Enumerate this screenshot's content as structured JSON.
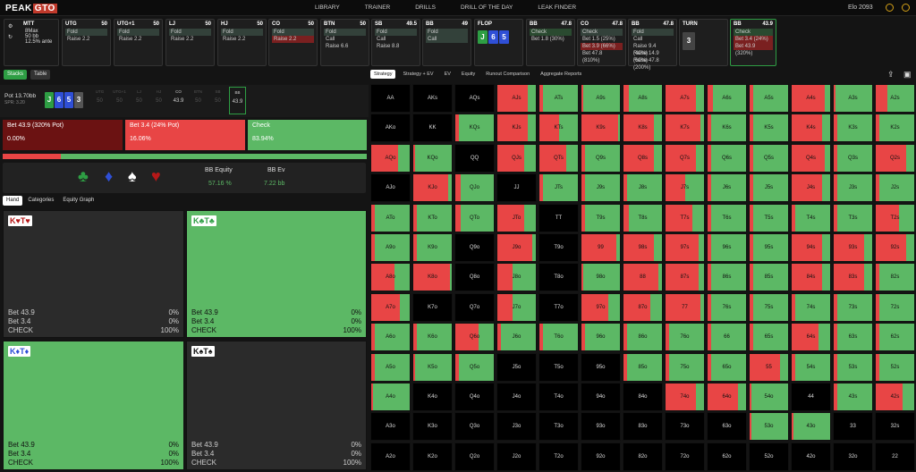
{
  "brand": {
    "name": "PEAK",
    "accent": "GTO"
  },
  "nav": [
    "LIBRARY",
    "TRAINER",
    "DRILLS",
    "DRILL OF THE DAY",
    "LEAK FINDER"
  ],
  "elo": "Elo 2093",
  "game": {
    "type": "MTT",
    "max": "8Max",
    "depth": "50 bb",
    "ante": "12.5% ante"
  },
  "seats": [
    {
      "name": "UTG",
      "stack": "50",
      "acts": [
        "Fold",
        "Raise 2.2"
      ],
      "hi": 0
    },
    {
      "name": "UTG+1",
      "stack": "50",
      "acts": [
        "Fold",
        "Raise 2.2"
      ],
      "hi": 0
    },
    {
      "name": "LJ",
      "stack": "50",
      "acts": [
        "Fold",
        "Raise 2.2"
      ],
      "hi": 0
    },
    {
      "name": "HJ",
      "stack": "50",
      "acts": [
        "Fold",
        "Raise 2.2"
      ],
      "hi": 0
    },
    {
      "name": "CO",
      "stack": "50",
      "acts": [
        "Fold",
        "Raise 2.2"
      ],
      "hi": 1
    },
    {
      "name": "BTN",
      "stack": "50",
      "acts": [
        "Fold",
        "Call",
        "Raise 6.6"
      ],
      "hi": 0
    },
    {
      "name": "SB",
      "stack": "49.5",
      "acts": [
        "Fold",
        "Call",
        "Raise 8.8"
      ],
      "hi": 0
    },
    {
      "name": "BB",
      "stack": "49",
      "acts": [
        "Fold",
        "Call"
      ],
      "hi": 1
    },
    {
      "name": "FLOP",
      "stack": "",
      "acts": [],
      "hi": 0
    },
    {
      "name": "BB",
      "stack": "47.8",
      "acts": [
        "Check",
        "Bet 1.8 (30%)"
      ],
      "hi": 0
    },
    {
      "name": "CO",
      "stack": "47.8",
      "acts": [
        "Check",
        "Bet 1.5 (25%)",
        "Bet 3.9 (66%)",
        "Bet 47.8 (810%)"
      ],
      "hi": 2
    },
    {
      "name": "BB",
      "stack": "47.8",
      "acts": [
        "Fold",
        "Call",
        "Raise 9.4 (40%)",
        "Raise 14.9 (60%)",
        "Raise 47.8 (200%)"
      ],
      "hi": 0
    },
    {
      "name": "TURN",
      "stack": "",
      "acts": [],
      "hi": 0
    },
    {
      "name": "BB",
      "stack": "43.9",
      "acts": [
        "Check",
        "Bet 3.4 (24%)",
        "Bet 43.9 (320%)"
      ],
      "hi": 0
    }
  ],
  "flop": [
    {
      "r": "J",
      "c": "#2e9e44"
    },
    {
      "r": "6",
      "c": "#2f4fd6"
    },
    {
      "r": "5",
      "c": "#2f4fd6"
    }
  ],
  "turn": {
    "r": "3",
    "c": "#444"
  },
  "tabs": {
    "stacks": "Stacks",
    "table": "Table"
  },
  "pot": {
    "label": "Pot",
    "value": "13.70bb",
    "spr": "SPR: 3.20",
    "board": [
      "J",
      "6",
      "5",
      "3"
    ],
    "pos": [
      {
        "n": "UTG",
        "v": "50"
      },
      {
        "n": "UTG+1",
        "v": "50"
      },
      {
        "n": "LJ",
        "v": "50"
      },
      {
        "n": "HJ",
        "v": "50"
      },
      {
        "n": "CO",
        "v": "43.9"
      },
      {
        "n": "BTN",
        "v": "50"
      },
      {
        "n": "SB",
        "v": "50"
      },
      {
        "n": "BB",
        "v": "43.9"
      }
    ]
  },
  "strategy": [
    {
      "label": "Bet 43.9 (320% Pot)",
      "pct": "0.00%",
      "color": "#6b1212"
    },
    {
      "label": "Bet 3.4 (24% Pot)",
      "pct": "16.06%",
      "color": "#e84545"
    },
    {
      "label": "Check",
      "pct": "83.94%",
      "color": "#5cb865"
    }
  ],
  "stats": {
    "eq_label": "BB Equity",
    "eq": "57.16 %",
    "ev_label": "BB Ev",
    "ev": "7.22 bb"
  },
  "subtabs": [
    "Hand",
    "Categories",
    "Equity Graph"
  ],
  "hands": [
    {
      "label": "K♥T♥",
      "suit": "h",
      "a": "0%",
      "b": "0%",
      "c": "100%",
      "green": false
    },
    {
      "label": "K♣T♣",
      "suit": "c",
      "a": "0%",
      "b": "0%",
      "c": "100%",
      "green": true
    },
    {
      "label": "K♦T♦",
      "suit": "d",
      "a": "0%",
      "b": "0%",
      "c": "100%",
      "green": true
    },
    {
      "label": "K♠T♠",
      "suit": "s",
      "a": "0%",
      "b": "0%",
      "c": "100%",
      "green": false
    }
  ],
  "handrows": {
    "a": "Bet 43.9",
    "b": "Bet 3.4",
    "c": "CHECK"
  },
  "gridtabs": [
    "Strategy",
    "Strategy + EV",
    "EV",
    "Equity",
    "Runout Comparison",
    "Aggregate Reports"
  ],
  "grid": [
    [
      "AA",
      "AKs",
      "AQs",
      "AJs",
      "ATs",
      "A9s",
      "A8s",
      "A7s",
      "A6s",
      "A5s",
      "A4s",
      "A3s",
      "A2s"
    ],
    [
      "AKo",
      "KK",
      "KQs",
      "KJs",
      "KTs",
      "K9s",
      "K8s",
      "K7s",
      "K6s",
      "K5s",
      "K4s",
      "K3s",
      "K2s"
    ],
    [
      "AQo",
      "KQo",
      "QQ",
      "QJs",
      "QTs",
      "Q9s",
      "Q8s",
      "Q7s",
      "Q6s",
      "Q5s",
      "Q4s",
      "Q3s",
      "Q2s"
    ],
    [
      "AJo",
      "KJo",
      "QJo",
      "JJ",
      "JTs",
      "J9s",
      "J8s",
      "J7s",
      "J6s",
      "J5s",
      "J4s",
      "J3s",
      "J2s"
    ],
    [
      "ATo",
      "KTo",
      "QTo",
      "JTo",
      "TT",
      "T9s",
      "T8s",
      "T7s",
      "T6s",
      "T5s",
      "T4s",
      "T3s",
      "T2s"
    ],
    [
      "A9o",
      "K9o",
      "Q9o",
      "J9o",
      "T9o",
      "99",
      "98s",
      "97s",
      "96s",
      "95s",
      "94s",
      "93s",
      "92s"
    ],
    [
      "A8o",
      "K8o",
      "Q8o",
      "J8o",
      "T8o",
      "98o",
      "88",
      "87s",
      "86s",
      "85s",
      "84s",
      "83s",
      "82s"
    ],
    [
      "A7o",
      "K7o",
      "Q7o",
      "J7o",
      "T7o",
      "97o",
      "87o",
      "77",
      "76s",
      "75s",
      "74s",
      "73s",
      "72s"
    ],
    [
      "A6o",
      "K6o",
      "Q6o",
      "J6o",
      "T6o",
      "96o",
      "86o",
      "76o",
      "66",
      "65s",
      "64s",
      "63s",
      "62s"
    ],
    [
      "A5o",
      "K5o",
      "Q5o",
      "J5o",
      "T5o",
      "95o",
      "85o",
      "75o",
      "65o",
      "55",
      "54s",
      "53s",
      "52s"
    ],
    [
      "A4o",
      "K4o",
      "Q4o",
      "J4o",
      "T4o",
      "94o",
      "84o",
      "74o",
      "64o",
      "54o",
      "44",
      "43s",
      "42s"
    ],
    [
      "A3o",
      "K3o",
      "Q3o",
      "J3o",
      "T3o",
      "93o",
      "83o",
      "73o",
      "63o",
      "53o",
      "43o",
      "33",
      "32s"
    ],
    [
      "A2o",
      "K2o",
      "Q2o",
      "J2o",
      "T2o",
      "92o",
      "82o",
      "72o",
      "62o",
      "52o",
      "42o",
      "32o",
      "22"
    ]
  ],
  "gridfreq": [
    [
      -1,
      -1,
      -1,
      0.2,
      0.9,
      0.95,
      0.85,
      0.2,
      0.85,
      0.9,
      0.15,
      0.95,
      0.7
    ],
    [
      -1,
      -1,
      0.9,
      0.2,
      0.5,
      0.05,
      0.2,
      0.1,
      0.9,
      0.9,
      0.2,
      0.9,
      0.9
    ],
    [
      0.3,
      0.95,
      -1,
      0.3,
      0.3,
      0.9,
      0.2,
      0.2,
      0.9,
      0.9,
      0.15,
      0.9,
      0.2
    ],
    [
      -1,
      0.1,
      0.85,
      -1,
      0.9,
      0.9,
      0.9,
      0.5,
      0.9,
      0.9,
      0.2,
      0.9,
      0.9
    ],
    [
      0.9,
      0.9,
      0.85,
      0.3,
      -1,
      0.9,
      0.85,
      0.3,
      0.9,
      0.9,
      0.9,
      0.9,
      0.4
    ],
    [
      0.9,
      0.9,
      -1,
      0.1,
      -1,
      0.1,
      0.2,
      0.15,
      0.9,
      0.9,
      0.2,
      0.2,
      0.2
    ],
    [
      0.4,
      0.05,
      -1,
      0.6,
      -1,
      0.95,
      0.1,
      0.15,
      0.9,
      0.9,
      0.2,
      0.2,
      0.9
    ],
    [
      0.25,
      -1,
      -1,
      0.6,
      -1,
      0.3,
      0.3,
      0.1,
      0.9,
      0.9,
      0.9,
      0.9,
      0.9
    ],
    [
      0.9,
      0.9,
      0.4,
      0.9,
      0.9,
      0.9,
      0.9,
      0.9,
      0.9,
      0.9,
      0.3,
      0.9,
      0.9
    ],
    [
      0.9,
      0.95,
      0.9,
      -1,
      -1,
      -1,
      0.9,
      0.9,
      0.9,
      0.2,
      0.9,
      0.9,
      0.9
    ],
    [
      0.95,
      -1,
      -1,
      -1,
      -1,
      -1,
      -1,
      0.2,
      0.2,
      0.95,
      -1,
      0.9,
      0.3
    ],
    [
      -1,
      -1,
      -1,
      -1,
      -1,
      -1,
      -1,
      -1,
      -1,
      0.95,
      0.95,
      -1,
      -1
    ],
    [
      -1,
      -1,
      -1,
      -1,
      -1,
      -1,
      -1,
      -1,
      -1,
      -1,
      -1,
      -1,
      -1
    ]
  ]
}
